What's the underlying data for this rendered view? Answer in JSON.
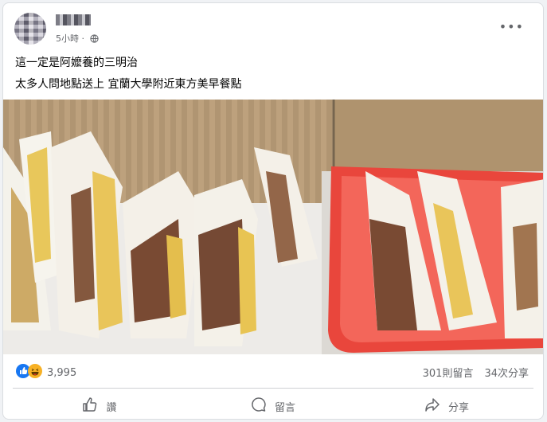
{
  "post": {
    "time": "5小時",
    "line1": "這一定是阿嬤養的三明治",
    "line2": "太多人問地點送上 宜蘭大學附近東方美早餐點",
    "more": "•••"
  },
  "stats": {
    "reaction_count": "3,995",
    "comments": "301則留言",
    "shares": "34次分享"
  },
  "actions": {
    "like": "讚",
    "comment": "留言",
    "share": "分享"
  },
  "colors": {
    "like_blue": "#1877f2",
    "haha_yellow": "#f7b125",
    "tray_red": "#e8372c"
  }
}
